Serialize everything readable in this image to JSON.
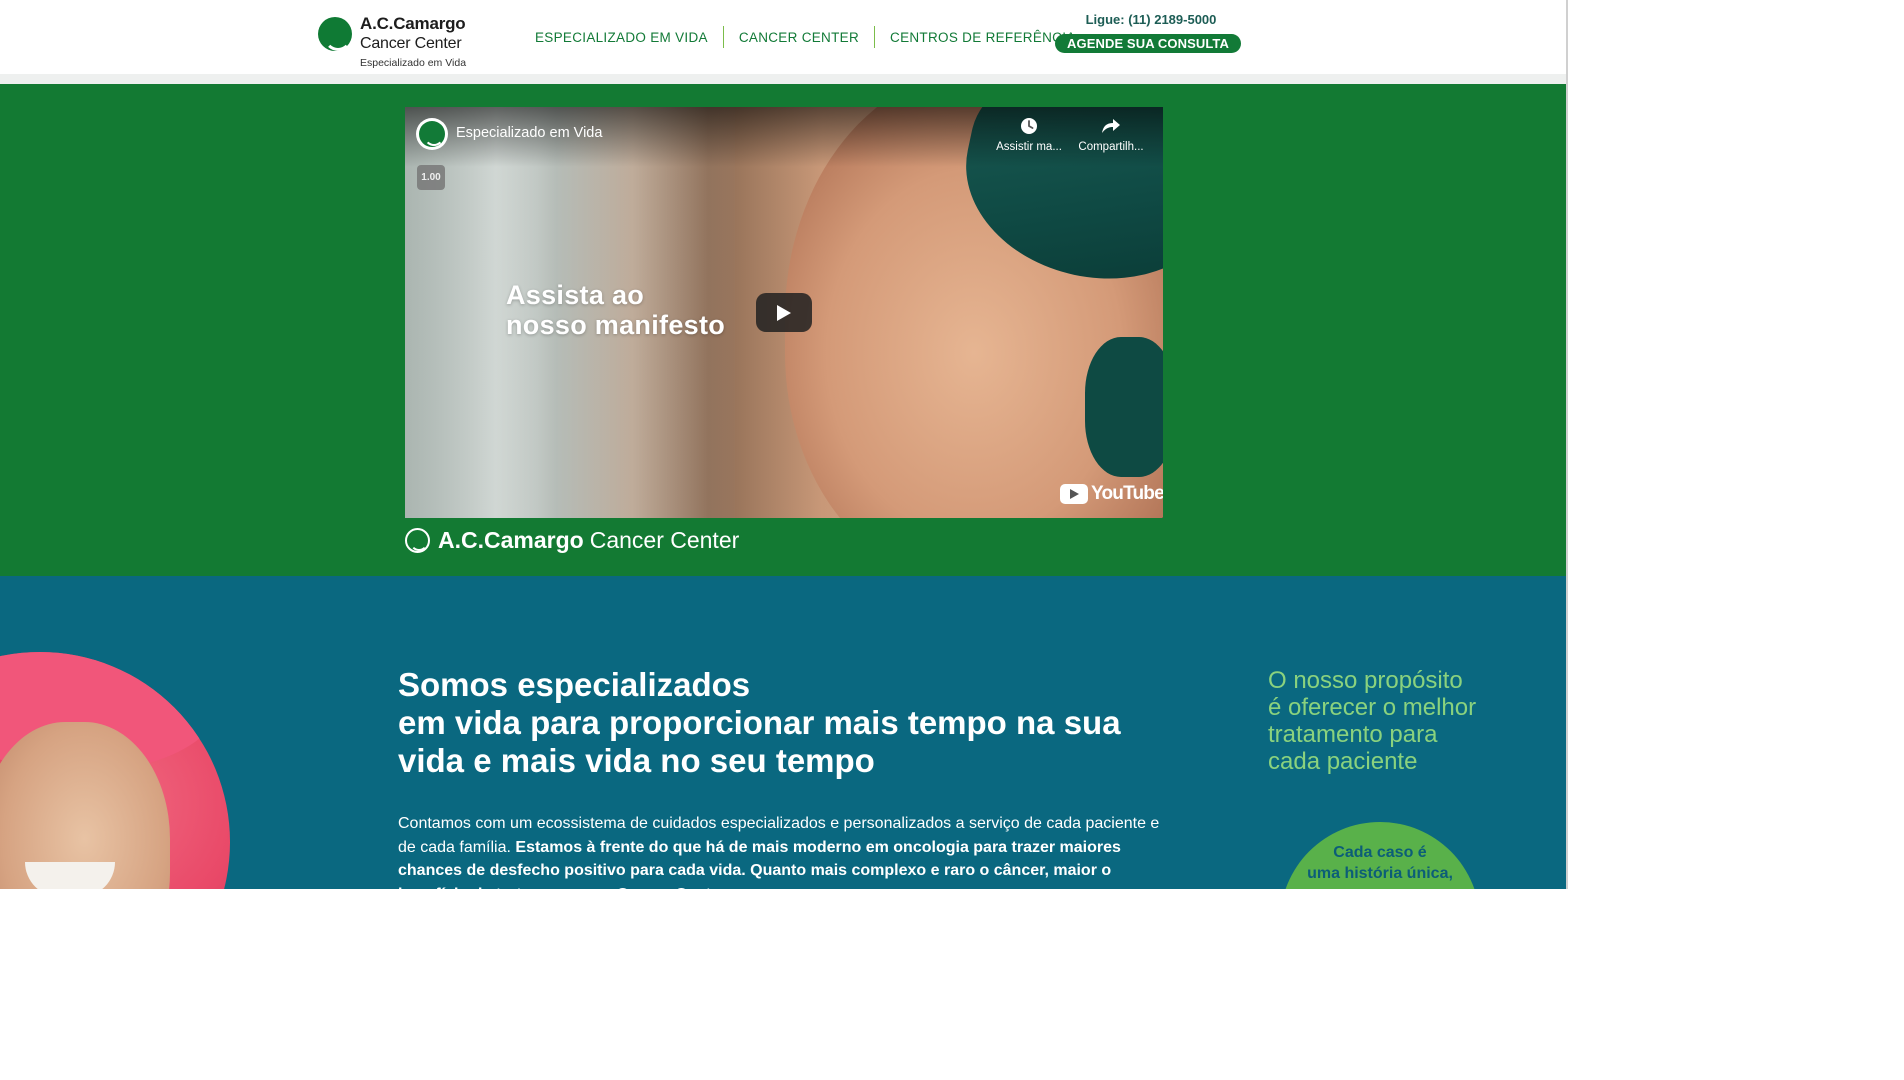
{
  "header": {
    "logo": {
      "line1": "A.C.Camargo",
      "line2": "Cancer Center",
      "line3": "Especializado em Vida"
    },
    "nav": [
      {
        "label": "ESPECIALIZADO EM VIDA"
      },
      {
        "label": "CANCER CENTER"
      },
      {
        "label": "CENTROS DE REFERÊNCIA"
      }
    ],
    "phone": "Ligue: (11) 2189-5000",
    "cta": "AGENDE SUA CONSULTA"
  },
  "video": {
    "channel_title": "Especializado em Vida",
    "speed": "1.00",
    "watch_later": "Assistir ma...",
    "share": "Compartilh...",
    "overlay_line1": "Assista ao",
    "overlay_line2": "nosso manifesto",
    "youtube_label": "YouTube"
  },
  "band_brand": {
    "bold": "A.C.Camargo",
    "regular": "Cancer Center"
  },
  "intro": {
    "headline_line1": "Somos especializados",
    "headline_line2": "em vida para proporcionar mais tempo na sua",
    "headline_line3": "vida e mais vida no seu tempo",
    "body_regular": "Contamos com um ecossistema de cuidados especializados e personalizados a serviço de cada paciente e de cada família.",
    "body_bold": "Estamos à frente do que há de mais moderno em oncologia para trazer maiores chances de desfecho positivo para cada vida. Quanto mais complexo e raro o câncer, maior o benefício de tratar no nosso Cancer Center."
  },
  "purpose": {
    "line1": "O nosso propósito",
    "line2": "é oferecer o melhor",
    "line3": "tratamento para",
    "line4": "cada paciente"
  },
  "case": {
    "line1": "Cada caso é",
    "line2": "uma história única,"
  },
  "colors": {
    "brand_green": "#137a33",
    "section_blue": "#0a6880",
    "accent_light_green": "#8ad27e"
  }
}
